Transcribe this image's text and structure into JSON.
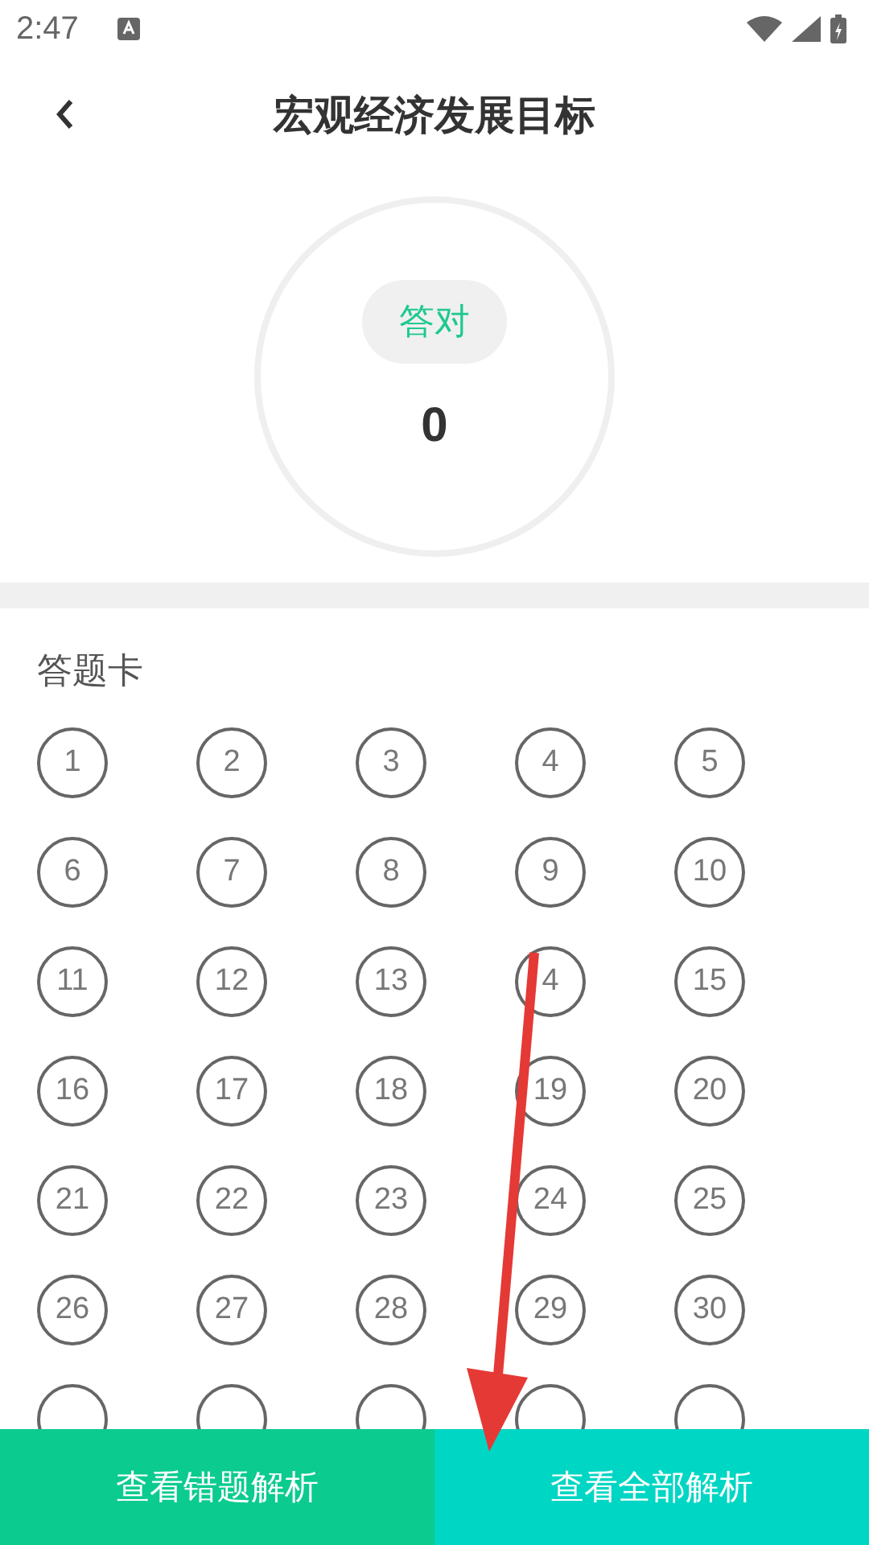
{
  "status_bar": {
    "time": "2:47"
  },
  "header": {
    "title": "宏观经济发展目标"
  },
  "score": {
    "label": "答对",
    "value": "0"
  },
  "answer_card": {
    "title": "答题卡",
    "items": [
      {
        "kind": "numbered",
        "number": "1"
      },
      {
        "kind": "numbered",
        "number": "2"
      },
      {
        "kind": "numbered",
        "number": "3"
      },
      {
        "kind": "numbered",
        "number": "4"
      },
      {
        "kind": "numbered",
        "number": "5"
      },
      {
        "kind": "numbered",
        "number": "6"
      },
      {
        "kind": "numbered",
        "number": "7"
      },
      {
        "kind": "numbered",
        "number": "8"
      },
      {
        "kind": "numbered",
        "number": "9"
      },
      {
        "kind": "numbered",
        "number": "10"
      },
      {
        "kind": "numbered",
        "number": "11"
      },
      {
        "kind": "numbered",
        "number": "12"
      },
      {
        "kind": "numbered",
        "number": "13"
      },
      {
        "kind": "numbered",
        "number": "4"
      },
      {
        "kind": "numbered",
        "number": "15"
      },
      {
        "kind": "numbered",
        "number": "16"
      },
      {
        "kind": "numbered",
        "number": "17"
      },
      {
        "kind": "numbered",
        "number": "18"
      },
      {
        "kind": "numbered",
        "number": "19"
      },
      {
        "kind": "numbered",
        "number": "20"
      },
      {
        "kind": "numbered",
        "number": "21"
      },
      {
        "kind": "numbered",
        "number": "22"
      },
      {
        "kind": "numbered",
        "number": "23"
      },
      {
        "kind": "numbered",
        "number": "24"
      },
      {
        "kind": "numbered",
        "number": "25"
      },
      {
        "kind": "numbered",
        "number": "26"
      },
      {
        "kind": "numbered",
        "number": "27"
      },
      {
        "kind": "numbered",
        "number": "28"
      },
      {
        "kind": "numbered",
        "number": "29"
      },
      {
        "kind": "numbered",
        "number": "30"
      },
      {
        "kind": "partial"
      },
      {
        "kind": "partial"
      },
      {
        "kind": "partial"
      },
      {
        "kind": "partial"
      },
      {
        "kind": "partial"
      }
    ]
  },
  "bottom_buttons": [
    {
      "label": "查看错题解析",
      "color": "#0bcb8f"
    },
    {
      "label": "查看全部解析",
      "color": "#00d6c4"
    }
  ]
}
